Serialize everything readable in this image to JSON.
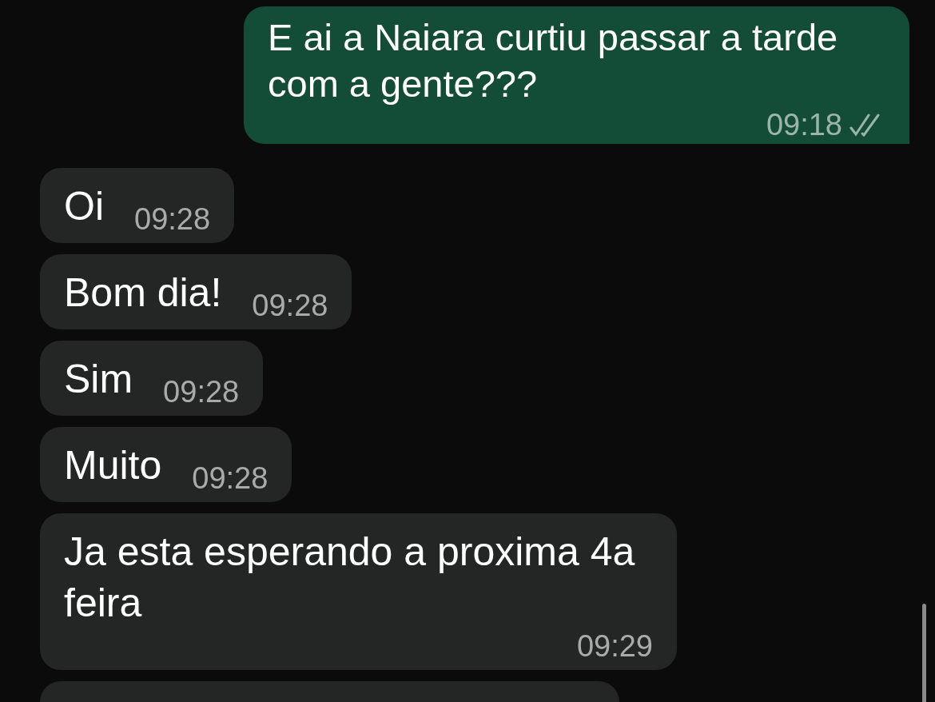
{
  "messages": [
    {
      "kind": "outgoing",
      "text": "E ai a Naiara curtiu passar a tarde com a gente???",
      "time": "09:18",
      "read": false
    },
    {
      "kind": "incoming",
      "text": "Oi",
      "time": "09:28"
    },
    {
      "kind": "incoming",
      "text": "Bom dia!",
      "time": "09:28"
    },
    {
      "kind": "incoming",
      "text": "Sim",
      "time": "09:28"
    },
    {
      "kind": "incoming",
      "text": "Muito",
      "time": "09:28"
    },
    {
      "kind": "incoming",
      "text": "Ja esta esperando a proxima 4a feira",
      "time": "09:29"
    }
  ]
}
